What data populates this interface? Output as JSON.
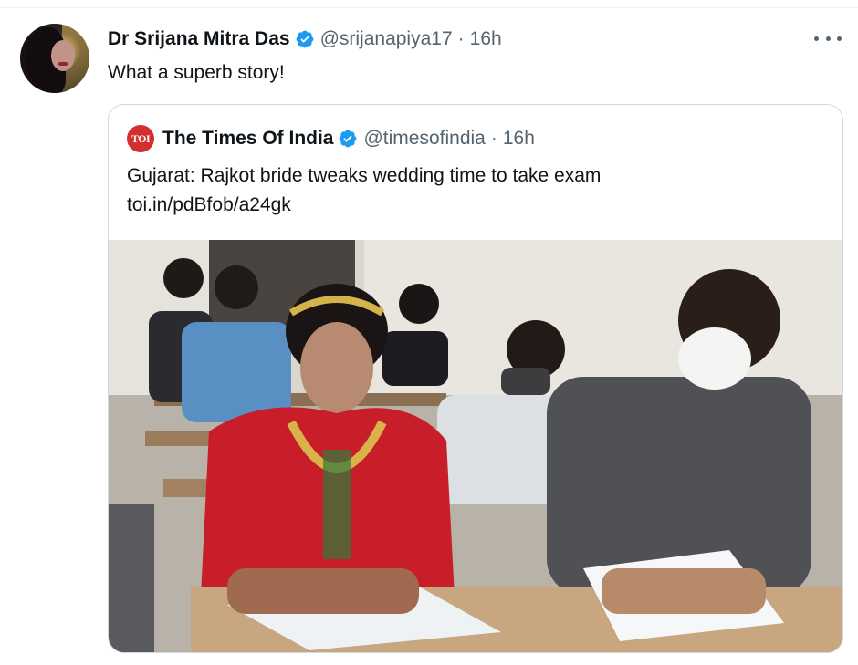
{
  "tweet": {
    "author_name": "Dr Srijana Mitra Das",
    "handle": "@srijanapiya17",
    "separator": "·",
    "time": "16h",
    "text": "What a superb story!"
  },
  "quoted_tweet": {
    "logo_text": "TOI",
    "author_name": "The Times Of India",
    "handle": "@timesofindia",
    "separator": "·",
    "time": "16h",
    "text_line1": "Gujarat: Rajkot bride tweaks wedding time to take exam",
    "link": "toi.in/pdBfob/a24gk"
  },
  "colors": {
    "verified_blue": "#1d9bf0",
    "secondary_text": "#536471",
    "border": "#cfd9de",
    "toi_red": "#d42e2e"
  },
  "icons": [
    "verified-badge-icon",
    "more-options-icon"
  ]
}
